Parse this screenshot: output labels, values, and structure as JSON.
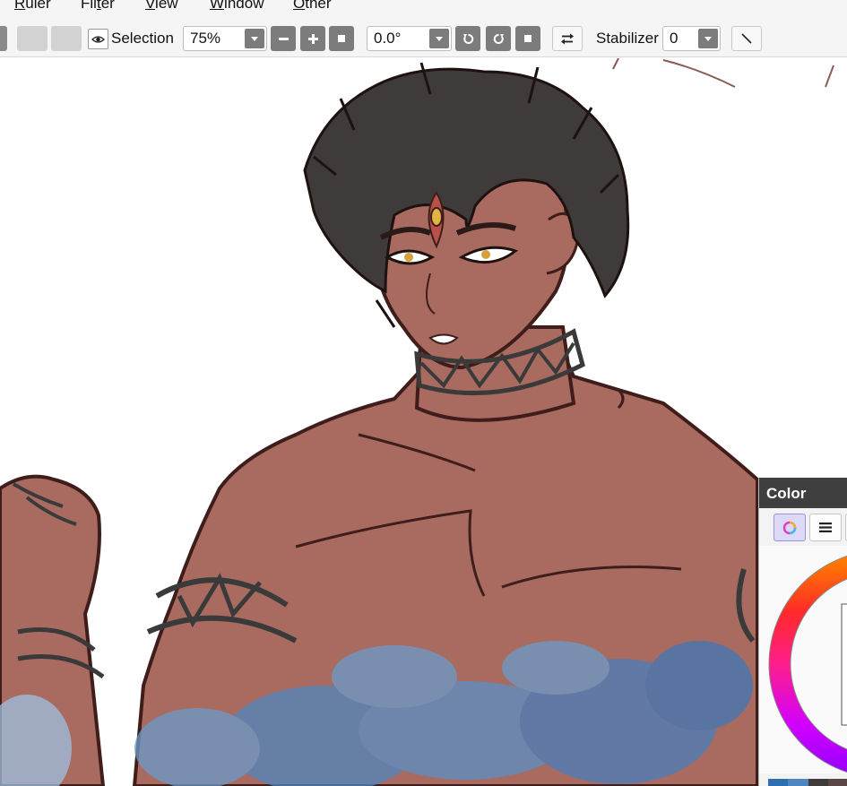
{
  "menu": {
    "items": [
      "Ruler",
      "Filter",
      "View",
      "Window",
      "Other"
    ],
    "underline": [
      "R",
      "t",
      "V",
      "W",
      "O"
    ]
  },
  "toolbar": {
    "selection_label": "Selection",
    "zoom_value": "75%",
    "rotation_value": "0.0°",
    "stabilizer_label": "Stabilizer",
    "stabilizer_value": "0"
  },
  "color_panel": {
    "title": "Color"
  },
  "colors": {
    "toolbar_bg": "#f5f5f5",
    "button_gray": "#7c7c7c",
    "skin": "#a96a5f",
    "hair": "#3f3b3a",
    "lineart": "#3e1d1a",
    "flame_blue": "#4f86c0",
    "panel_title_bg": "#3f3f3f",
    "active_tab": "#dcd9f7"
  },
  "icons": [
    "eye-icon",
    "minus-icon",
    "plus-icon",
    "square-icon",
    "rotate-left-icon",
    "rotate-right-icon",
    "flip-icon",
    "line-icon",
    "color-wheel-icon",
    "list-icon",
    "chevron-down-icon"
  ]
}
